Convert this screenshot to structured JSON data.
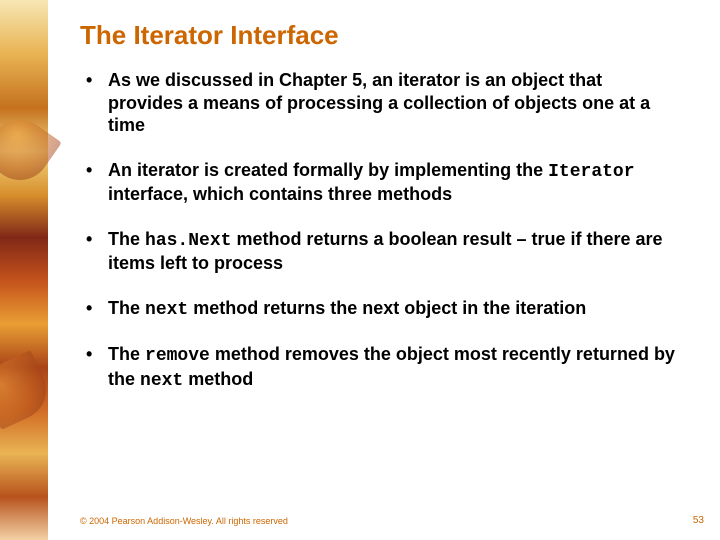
{
  "title": "The Iterator Interface",
  "bullets": [
    {
      "segments": [
        {
          "text": "As we discussed in Chapter 5, an iterator is an object that provides a means of processing a collection of objects one at a time",
          "code": false
        }
      ]
    },
    {
      "segments": [
        {
          "text": "An iterator is created formally by implementing the ",
          "code": false
        },
        {
          "text": "Iterator",
          "code": true
        },
        {
          "text": " interface, which contains three methods",
          "code": false
        }
      ]
    },
    {
      "segments": [
        {
          "text": "The ",
          "code": false
        },
        {
          "text": "has.Next",
          "code": true
        },
        {
          "text": " method returns a boolean result – true if there are items left to process",
          "code": false
        }
      ]
    },
    {
      "segments": [
        {
          "text": "The ",
          "code": false
        },
        {
          "text": "next",
          "code": true
        },
        {
          "text": " method returns the next object in the iteration",
          "code": false
        }
      ]
    },
    {
      "segments": [
        {
          "text": "The ",
          "code": false
        },
        {
          "text": "remove",
          "code": true
        },
        {
          "text": " method removes the object most recently returned by the ",
          "code": false
        },
        {
          "text": "next",
          "code": true
        },
        {
          "text": " method",
          "code": false
        }
      ]
    }
  ],
  "footer": "© 2004 Pearson Addison-Wesley. All rights reserved",
  "page_number": "53"
}
